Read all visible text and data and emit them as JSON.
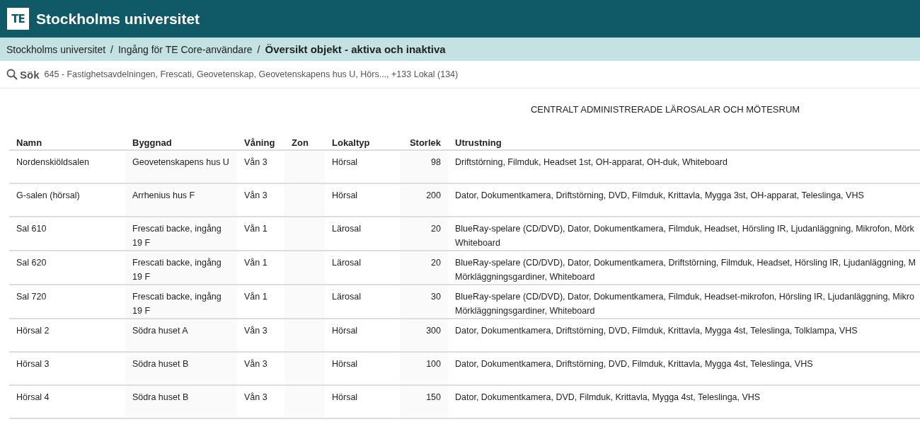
{
  "header": {
    "logo": "TE",
    "title": "Stockholms universitet"
  },
  "breadcrumb_separator": "/",
  "breadcrumb": [
    {
      "label": "Stockholms universitet",
      "current": false
    },
    {
      "label": "Ingång för TE Core-användare",
      "current": false
    },
    {
      "label": "Översikt objekt - aktiva och inaktiva",
      "current": true
    }
  ],
  "search": {
    "label": "Sök",
    "value": "645 - Fastighetsavdelningen, Frescati, Geovetenskap, Geovetenskapens hus U, Hörs..., +133 Lokal (134)"
  },
  "report_title": "CENTRALT ADMINISTRERADE LÄROSALAR OCH MÖTESRUM",
  "table": {
    "columns": [
      "Namn",
      "Byggnad",
      "Våning",
      "Zon",
      "Lokaltyp",
      "Storlek",
      "Utrustning"
    ],
    "rows": [
      {
        "namn": "Nordenskiöldsalen",
        "byggnad": "Geovetenskapens hus U",
        "vaning": "Vån 3",
        "lokaltyp": "Hörsal",
        "storlek": "98",
        "utrustning": [
          "Driftstörning, Filmduk, Headset 1st, OH-apparat, OH-duk, Whiteboard"
        ]
      },
      {
        "namn": "G-salen (hörsal)",
        "byggnad": "Arrhenius hus F",
        "vaning": "Vån 3",
        "lokaltyp": "Hörsal",
        "storlek": "200",
        "utrustning": [
          "Dator, Dokumentkamera, Driftstörning, DVD, Filmduk, Krittavla, Mygga 3st, OH-apparat, Teleslinga, VHS"
        ]
      },
      {
        "namn": "Sal 610",
        "byggnad": "Frescati backe, ingång 19 F",
        "vaning": "Vån 1",
        "lokaltyp": "Lärosal",
        "storlek": "20",
        "utrustning": [
          "BlueRay-spelare (CD/DVD), Dator, Dokumentkamera, Filmduk, Headset, Hörsling IR, Ljudanläggning, Mikrofon, Mörk",
          "Whiteboard"
        ]
      },
      {
        "namn": "Sal 620",
        "byggnad": "Frescati backe, ingång 19 F",
        "vaning": "Vån 1",
        "lokaltyp": "Lärosal",
        "storlek": "20",
        "utrustning": [
          "BlueRay-spelare (CD/DVD), Dator, Dokumentkamera, Driftstörning, Filmduk, Headset, Hörsling IR, Ljudanläggning, M",
          "Mörkläggningsgardiner, Whiteboard"
        ]
      },
      {
        "namn": "Sal 720",
        "byggnad": "Frescati backe, ingång 19 F",
        "vaning": "Vån 1",
        "lokaltyp": "Lärosal",
        "storlek": "30",
        "utrustning": [
          "BlueRay-spelare (CD/DVD), Dator, Dokumentkamera, Filmduk, Headset-mikrofon, Hörsling IR, Ljudanläggning, Mikro",
          "Mörkläggningsgardiner, Whiteboard"
        ]
      },
      {
        "namn": "Hörsal 2",
        "byggnad": "Södra huset A",
        "vaning": "Vån 3",
        "lokaltyp": "Hörsal",
        "storlek": "300",
        "utrustning": [
          "Dator, Dokumentkamera, Driftstörning, DVD, Filmduk, Krittavla, Mygga 4st, Teleslinga, Tolklampa, VHS"
        ]
      },
      {
        "namn": "Hörsal 3",
        "byggnad": "Södra huset B",
        "vaning": "Vån 3",
        "lokaltyp": "Hörsal",
        "storlek": "100",
        "utrustning": [
          "Dator, Dokumentkamera, Driftstörning, DVD, Filmduk, Krittavla, Mygga 4st, Teleslinga, VHS"
        ]
      },
      {
        "namn": "Hörsal 4",
        "byggnad": "Södra huset B",
        "vaning": "Vån 3",
        "lokaltyp": "Hörsal",
        "storlek": "150",
        "utrustning": [
          "Dator, Dokumentkamera, DVD, Filmduk, Krittavla, Mygga 4st, Teleslinga, VHS"
        ]
      }
    ]
  }
}
